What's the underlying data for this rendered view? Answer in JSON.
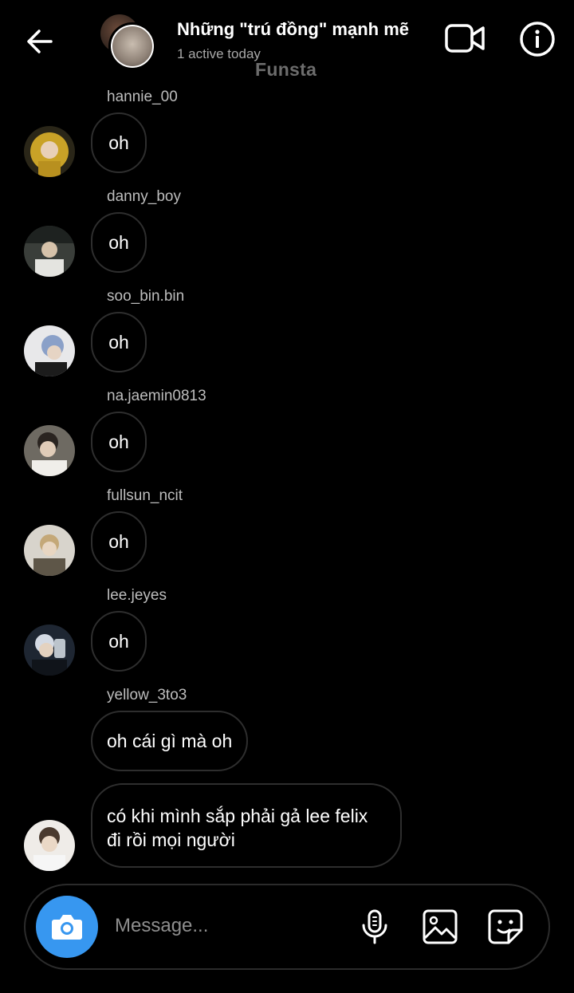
{
  "header": {
    "title": "Những \"trú đồng\" mạnh mẽ",
    "subtitle": "1 active today",
    "watermark": "Funsta"
  },
  "messages": [
    {
      "sender": "hannie_00",
      "text": "oh",
      "avatar_color": "#c9a227"
    },
    {
      "sender": "danny_boy",
      "text": "oh",
      "avatar_color": "#5a5f5a"
    },
    {
      "sender": "soo_bin.bin",
      "text": "oh",
      "avatar_color": "#8aa0c8"
    },
    {
      "sender": "na.jaemin0813",
      "text": "oh",
      "avatar_color": "#8c8378"
    },
    {
      "sender": "fullsun_ncit",
      "text": "oh",
      "avatar_color": "#6e6452"
    },
    {
      "sender": "lee.jeyes",
      "text": "oh",
      "avatar_color": "#2f3a4a"
    },
    {
      "sender": "yellow_3to3",
      "text": "oh cái gì mà oh"
    },
    {
      "text": "có khi mình sắp phải gả lee felix đi rồi mọi người",
      "avatar_color": "#d8d4cf"
    }
  ],
  "composer": {
    "placeholder": "Message..."
  },
  "colors": {
    "background": "#000000",
    "camera_button": "#3797f0",
    "bubble_border": "#2e2e2e",
    "secondary_text": "#a8a8a8"
  },
  "icons": {
    "back": "arrow-left-icon",
    "video": "video-camera-icon",
    "info": "info-icon",
    "camera": "camera-icon",
    "mic": "microphone-icon",
    "gallery": "image-icon",
    "sticker": "sticker-icon"
  }
}
